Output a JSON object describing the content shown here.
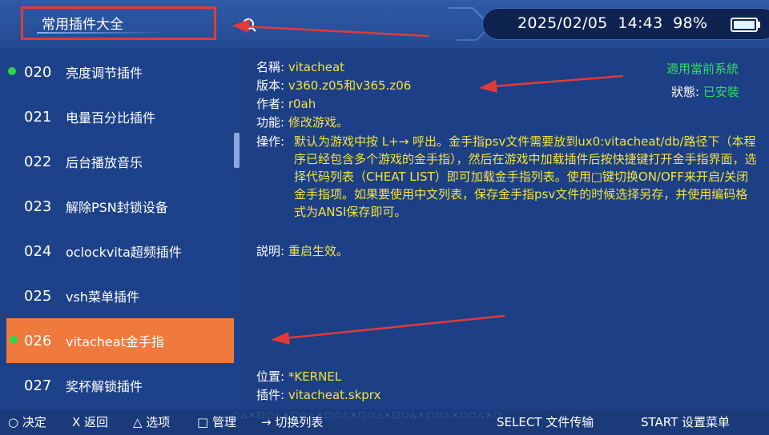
{
  "header": {
    "title": "常用插件大全",
    "datetime": "2025/02/05",
    "time": "14:43",
    "battery": "98%"
  },
  "list": {
    "items": [
      {
        "num": "020",
        "name": "亮度调节插件",
        "active": true
      },
      {
        "num": "021",
        "name": "电量百分比插件",
        "active": false
      },
      {
        "num": "022",
        "name": "后台播放音乐",
        "active": false
      },
      {
        "num": "023",
        "name": "解除PSN封锁设备",
        "active": false
      },
      {
        "num": "024",
        "name": "oclockvita超频插件",
        "active": false
      },
      {
        "num": "025",
        "name": "vsh菜单插件",
        "active": false
      },
      {
        "num": "026",
        "name": "vitacheat金手指",
        "active": true,
        "selected": true
      },
      {
        "num": "027",
        "name": "奖杯解锁插件",
        "active": false
      }
    ]
  },
  "detail": {
    "name_label": "名稱:",
    "name_value": "vitacheat",
    "version_label": "版本:",
    "version_value": "v360.z05和v365.z06",
    "author_label": "作者:",
    "author_value": "r0ah",
    "function_label": "功能:",
    "function_value": "修改游戏。",
    "op_label": "操作:",
    "op_value": "默认为游戏中按 L+→ 呼出。金手指psv文件需要放到ux0:vitacheat/db/路径下（本程序已经包含多个游戏的金手指），然后在游戏中加载插件后按快捷键打开金手指界面，选择代码列表（CHEAT LIST）即可加载金手指列表。使用□键切换ON/OFF来开启/关闭金手指项。如果要使用中文列表，保存金手指psv文件的时候选择另存，并使用编码格式为ANSI保存即可。",
    "desc_label": "説明:",
    "desc_value": "重启生效。",
    "compat": "適用當前系統",
    "state_label": "狀態:",
    "state_value": "已安裝",
    "location_label": "位置:",
    "location_value": "*KERNEL",
    "plugin_label": "插件:",
    "plugin_value": "vitacheat.skprx"
  },
  "footer": {
    "confirm": "○ 决定",
    "back": "X 返回",
    "options": "△ 选项",
    "manage": "□ 管理",
    "switch": "→ 切换列表",
    "select": "SELECT 文件传输",
    "start": "START 设置菜单"
  },
  "colors": {
    "value_yellow": "#f3e53a",
    "status_green": "#2fe05c",
    "selected_orange": "#f07a3e",
    "annotation_red": "#e23a3a"
  }
}
